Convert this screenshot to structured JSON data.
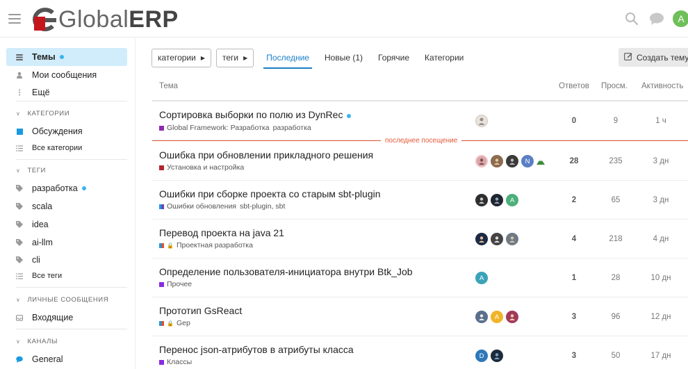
{
  "header": {
    "logo_text_light": "Global",
    "logo_text_bold": "ERP",
    "avatar_letter": "A",
    "icons": [
      "hamburger-icon",
      "search-icon",
      "chat-icon"
    ]
  },
  "sidebar": {
    "top_items": [
      {
        "label": "Темы",
        "icon": "topics-icon"
      },
      {
        "label": "Мои сообщения",
        "icon": "user-icon"
      },
      {
        "label": "Ещё",
        "icon": "more-vertical-icon"
      }
    ],
    "categories_title": "КАТЕГОРИИ",
    "categories": [
      {
        "label": "Обсуждения"
      },
      {
        "label": "Все категории"
      }
    ],
    "tags_title": "ТЕГИ",
    "tags": [
      "разработка",
      "scala",
      "idea",
      "ai-llm",
      "cli"
    ],
    "all_tags": "Все теги",
    "messages_title": "ЛИЧНЫЕ СООБЩЕНИЯ",
    "inbox": "Входящие",
    "channels_title": "КАНАЛЫ",
    "channel_general": "General"
  },
  "nav": {
    "categories_dd": "категории",
    "tags_dd": "теги",
    "tabs": [
      "Последние",
      "Новые (1)",
      "Горячие",
      "Категории"
    ],
    "create_topic": "Создать тему"
  },
  "table": {
    "columns": [
      "Тема",
      "Ответов",
      "Просм.",
      "Активность"
    ],
    "last_visit_label": "последнее посещение",
    "rows": [
      {
        "title": "Сортировка выборки по полю из DynRec",
        "category": "Global Framework: Разработка",
        "tags": "разработка",
        "replies": "0",
        "views": "9",
        "activity": "1 ч"
      },
      {
        "title": "Ошибка при обновлении прикладного решения",
        "category": "Установка и настройка",
        "tags": "",
        "replies": "28",
        "views": "235",
        "activity": "3 дн"
      },
      {
        "title": "Ошибки при сборке проекта со старым sbt-plugin",
        "category": "Ошибки обновления",
        "tags": "sbt-plugin, sbt",
        "replies": "2",
        "views": "65",
        "activity": "3 дн"
      },
      {
        "title": "Перевод проекта на java 21",
        "category": "Проектная разработка",
        "tags": "",
        "replies": "4",
        "views": "218",
        "activity": "4 дн"
      },
      {
        "title": "Определение пользователя-инициатора внутри Btk_Job",
        "category": "Прочее",
        "tags": "",
        "replies": "1",
        "views": "28",
        "activity": "10 дн"
      },
      {
        "title": "Прототип GsReact",
        "category": "Gep",
        "tags": "",
        "replies": "3",
        "views": "96",
        "activity": "12 дн"
      },
      {
        "title": "Перенос json-атрибутов в атрибуты класса",
        "category": "Классы",
        "tags": "",
        "replies": "3",
        "views": "50",
        "activity": "17 дн"
      }
    ],
    "avatar_letters": {
      "r1_n": "N",
      "r2_a": "A",
      "r4_a": "A",
      "r6_d": "D"
    }
  },
  "colors": {
    "accent": "#1a7fc8",
    "active_bg": "#d1ecfb",
    "brand_red": "#c5161d",
    "last_visit": "#e45735",
    "unread_dot": "#3ab5ec"
  }
}
